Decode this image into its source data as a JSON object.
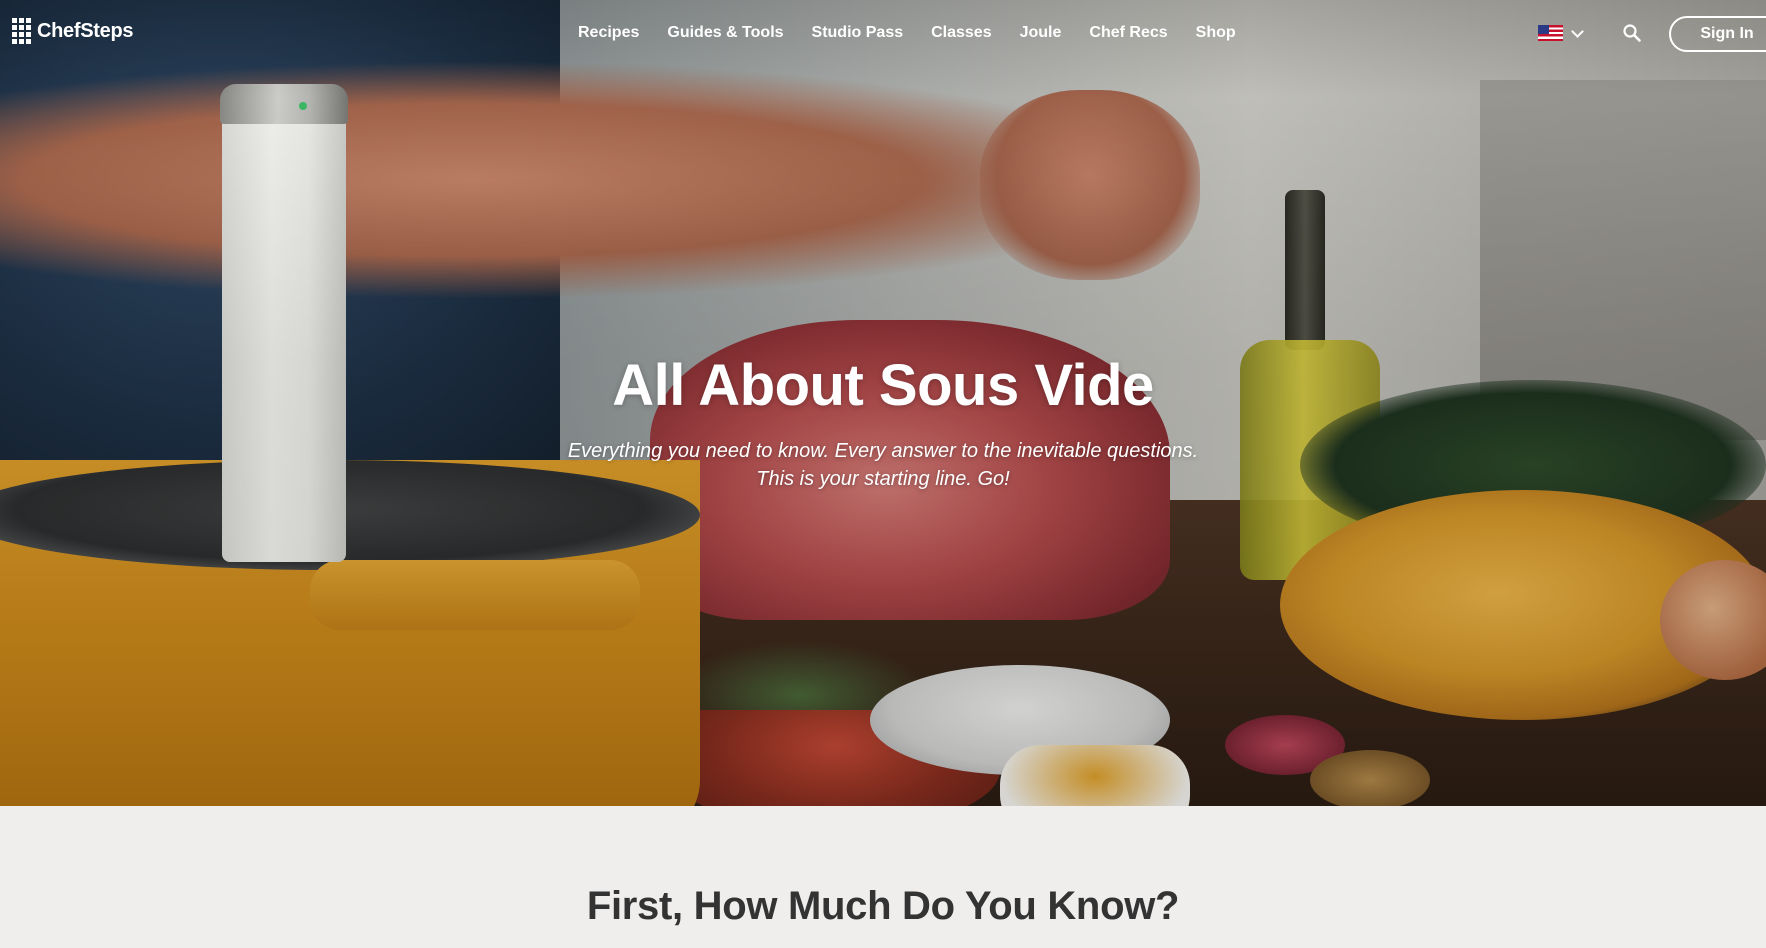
{
  "brand": {
    "name": "ChefSteps"
  },
  "nav": {
    "items": [
      {
        "label": "Recipes"
      },
      {
        "label": "Guides & Tools"
      },
      {
        "label": "Studio Pass"
      },
      {
        "label": "Classes"
      },
      {
        "label": "Joule"
      },
      {
        "label": "Chef Recs"
      },
      {
        "label": "Shop"
      }
    ],
    "locale_icon": "us-flag-icon",
    "search_icon": "search-icon",
    "sign_in_label": "Sign In"
  },
  "hero": {
    "title": "All About Sous Vide",
    "subtitle_line1": "Everything you need to know. Every answer to the inevitable questions.",
    "subtitle_line2": "This is your starting line. Go!"
  },
  "section": {
    "title": "First, How Much Do You Know?"
  },
  "colors": {
    "nav_text": "#ffffff",
    "section_bg": "#efeeec",
    "section_title": "#333333"
  }
}
